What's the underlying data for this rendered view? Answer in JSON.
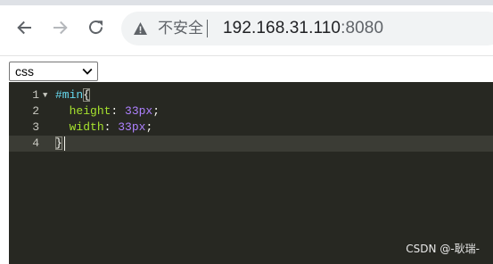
{
  "browser": {
    "security_label": "不安全",
    "url_host": "192.168.31.110",
    "url_port": ":8080",
    "icons": [
      "back-arrow-icon",
      "forward-arrow-icon",
      "reload-icon",
      "warning-icon"
    ]
  },
  "language_select": {
    "value": "css"
  },
  "editor": {
    "line_numbers": [
      "1",
      "2",
      "3",
      "4"
    ],
    "lines": [
      {
        "indent": "",
        "prop": "",
        "value": "",
        "selector": "#min",
        "brace": "{"
      },
      {
        "indent": "  ",
        "prop": "height",
        "colon": ": ",
        "value": "33px",
        "end": ";"
      },
      {
        "indent": "  ",
        "prop": "width",
        "colon": ": ",
        "value": "33px",
        "end": ";"
      },
      {
        "indent": "",
        "brace": "}"
      }
    ],
    "theme_colors": {
      "background": "#272822",
      "selector": "#66d9ef",
      "property": "#a6e22e",
      "number": "#ae81ff"
    }
  },
  "watermark": "CSDN @-耿瑞-"
}
